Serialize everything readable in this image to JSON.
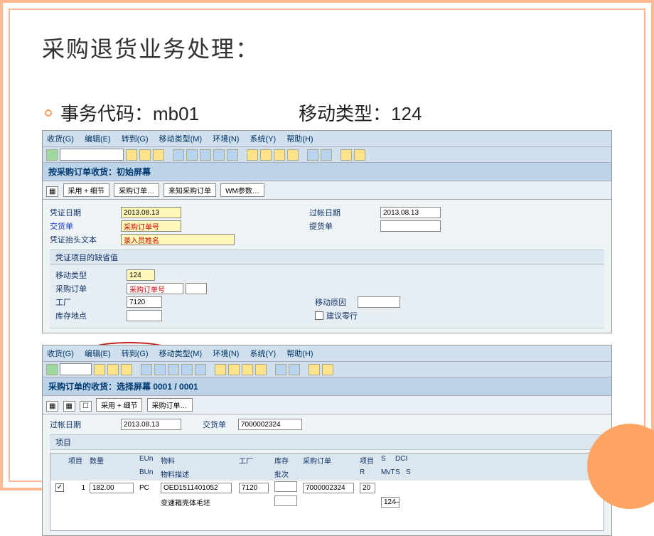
{
  "slide": {
    "title": "采购退货业务处理：",
    "tcode_label": "事务代码：mb01",
    "mvt_label": "移动类型：124"
  },
  "shot1": {
    "menu": [
      "收货(G)",
      "编辑(E)",
      "转到(G)",
      "移动类型(M)",
      "环境(N)",
      "系统(Y)",
      "帮助(H)"
    ],
    "title": "按采购订单收货：初始屏幕",
    "app_buttons": [
      "采用 + 细节",
      "采购订单…",
      "来知采购订单",
      "WM参数…"
    ],
    "rows": {
      "doc_date_lbl": "凭证日期",
      "doc_date_val": "2013.08.13",
      "post_date_lbl": "过帐日期",
      "post_date_val": "2013.08.13",
      "slip_lbl": "交货单",
      "slip_val": "采购订单号",
      "bill_lbl": "提货单",
      "header_lbl": "凭证抬头文本",
      "header_val": "录入员姓名",
      "section": "凭证项目的缺省值",
      "mvt_lbl": "移动类型",
      "mvt_val": "124",
      "po_lbl": "采购订单",
      "po_val": "采购订单号",
      "plant_lbl": "工厂",
      "plant_val": "7120",
      "reason_lbl": "移动原因",
      "sloc_lbl": "库存地点",
      "suggest_lbl": "建议零行"
    }
  },
  "shot2": {
    "menu": [
      "收货(G)",
      "编辑(E)",
      "转到(G)",
      "移动类型(M)",
      "环境(N)",
      "系统(Y)",
      "帮助(H)"
    ],
    "title": "采购订单的收货：选择屏幕 0001 / 0001",
    "app_buttons": [
      "采用 + 细节",
      "采购订单…"
    ],
    "post_date_lbl": "过帐日期",
    "post_date_val": "2013.08.13",
    "slip_lbl": "交货单",
    "slip_val": "7000002324",
    "grid_section": "项目",
    "headers": {
      "item": "项目",
      "qty": "数量",
      "eun": "EUn",
      "mat": "物料",
      "plant": "工厂",
      "sloc": "库存",
      "po": "采购订单",
      "poitm": "项目",
      "s": "S",
      "dci": "DCI",
      "bun": "BUn",
      "matdesc": "物料描述",
      "batch": "批次",
      "r": "R",
      "mvt": "MvT",
      "s2": "S",
      "s3": "S"
    },
    "row": {
      "chk": "✓",
      "item": "1",
      "qty": "182.00",
      "eun": "PC",
      "mat": "OED1511401052",
      "plant": "7120",
      "po": "7000002324",
      "poitm": "20",
      "mvt": "124",
      "sign": "–",
      "desc": "变速箱壳体毛坯"
    }
  }
}
